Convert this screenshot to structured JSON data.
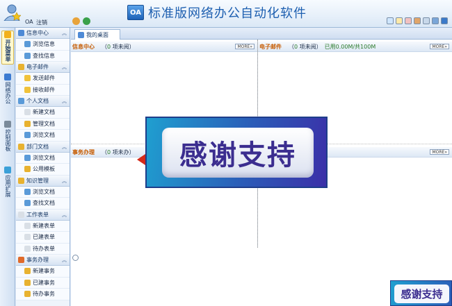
{
  "app": {
    "logo": "OA",
    "title": "标准版网络办公自动化软件"
  },
  "user": {
    "name": "OA",
    "logout": "注销"
  },
  "categories": [
    {
      "label": "开始菜单",
      "icon": "lightbulb-icon",
      "color": "#f2b01c"
    },
    {
      "label": "网络办公",
      "icon": "network-icon",
      "color": "#3c7bd1"
    },
    {
      "label": "控制面板",
      "icon": "wrench-icon",
      "color": "#7a8a9a"
    },
    {
      "label": "应用扩展",
      "icon": "star-icon",
      "color": "#3aa0d8"
    }
  ],
  "menu": [
    {
      "label": "信息中心",
      "items": [
        "浏览信息",
        "查找信息"
      ]
    },
    {
      "label": "电子邮件",
      "items": [
        "发送邮件",
        "接收邮件"
      ]
    },
    {
      "label": "个人文档",
      "items": [
        "新建文档",
        "管理文档",
        "浏览文档"
      ]
    },
    {
      "label": "部门文档",
      "items": [
        "浏览文档",
        "公用模板"
      ]
    },
    {
      "label": "知识管理",
      "items": [
        "浏览文档",
        "查找文档"
      ]
    },
    {
      "label": "工作表单",
      "items": [
        "新建表单",
        "已建表单",
        "待办表单"
      ]
    },
    {
      "label": "事务办理",
      "items": [
        "新建事务",
        "已建事务",
        "待办事务"
      ]
    }
  ],
  "tab": {
    "label": "我的桌面"
  },
  "panels": {
    "info": {
      "title": "信息中心",
      "count_prefix": "（",
      "count": "0",
      "count_suffix": " 项未阅）",
      "more": "MORE»"
    },
    "mail": {
      "title": "电子邮件",
      "count_prefix": "（",
      "count": "0",
      "count_suffix": " 项未阅）",
      "usage": "已用0.00M/共100M",
      "more": "MORE»"
    },
    "affairs": {
      "title": "事务办理",
      "count_prefix": "（",
      "count": "0",
      "count_suffix": " 项未办）",
      "more": "MORE»"
    }
  },
  "banner": {
    "text": "感谢支持"
  },
  "mini_banner": {
    "text": "感谢支持"
  }
}
